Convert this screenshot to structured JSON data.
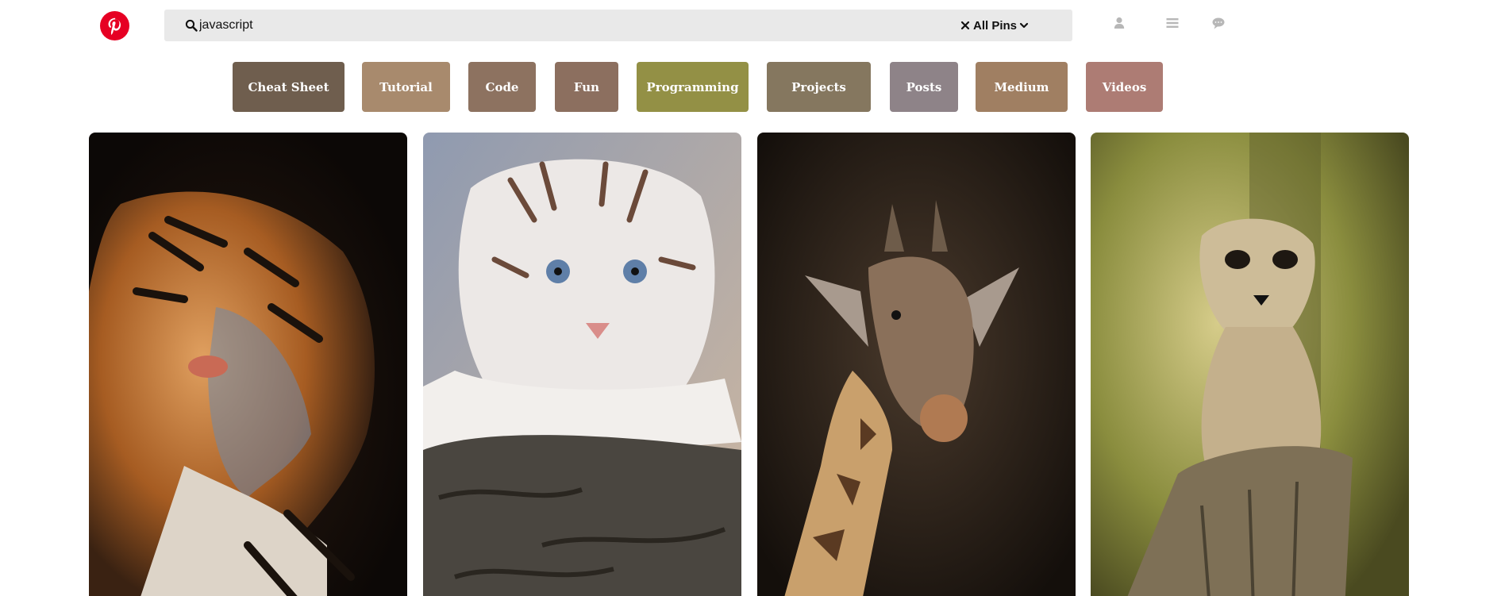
{
  "search": {
    "query": "javascript",
    "filter_label": "All Pins"
  },
  "categories": [
    {
      "label": "Cheat Sheet",
      "color": "#6f5e4e"
    },
    {
      "label": "Tutorial",
      "color": "#a88a6d"
    },
    {
      "label": "Code",
      "color": "#8d7260"
    },
    {
      "label": "Fun",
      "color": "#8c6f5f"
    },
    {
      "label": "Programming",
      "color": "#939045"
    },
    {
      "label": "Projects",
      "color": "#85775f"
    },
    {
      "label": "Posts",
      "color": "#8e8388"
    },
    {
      "label": "Medium",
      "color": "#a07f62"
    },
    {
      "label": "Videos",
      "color": "#ad7c74"
    }
  ],
  "pins": [
    {
      "subject": "tiger"
    },
    {
      "subject": "white tiger cub"
    },
    {
      "subject": "giraffe"
    },
    {
      "subject": "meerkat"
    }
  ],
  "colors": {
    "brand": "#e60023",
    "search_bg": "#e9e9e9",
    "nav_icon": "#b7b7b7"
  }
}
